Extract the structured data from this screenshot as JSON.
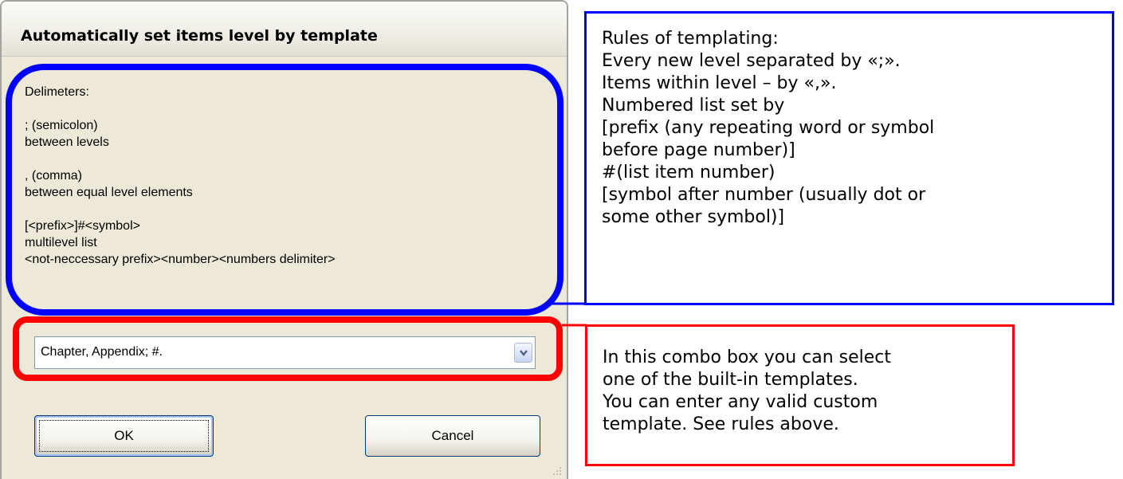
{
  "dialog": {
    "title": "Automatically set items level by template",
    "info_text": "Delimeters:\n\n; (semicolon)\nbetween levels\n\n, (comma)\nbetween equal level elements\n\n[<prefix>]#<symbol>\nmultilevel list\n<not-neccessary prefix><number><numbers delimiter>",
    "template_combo": {
      "value": "Chapter, Appendix; #."
    },
    "ok_label": "OK",
    "cancel_label": "Cancel"
  },
  "annotations": {
    "rules_text": "Rules of templating:\nEvery new level separated by «;».\nItems within level – by «,».\nNumbered list set by\n[prefix (any repeating word or symbol\nbefore page number)]\n#(list item number)\n[symbol after number (usually dot or\nsome other symbol)]",
    "combo_text": "In this combo box you can select\none of the built-in templates.\nYou can enter any valid custom\ntemplate. See rules above.",
    "colors": {
      "blue": "#0000ff",
      "red": "#ff0000"
    }
  }
}
